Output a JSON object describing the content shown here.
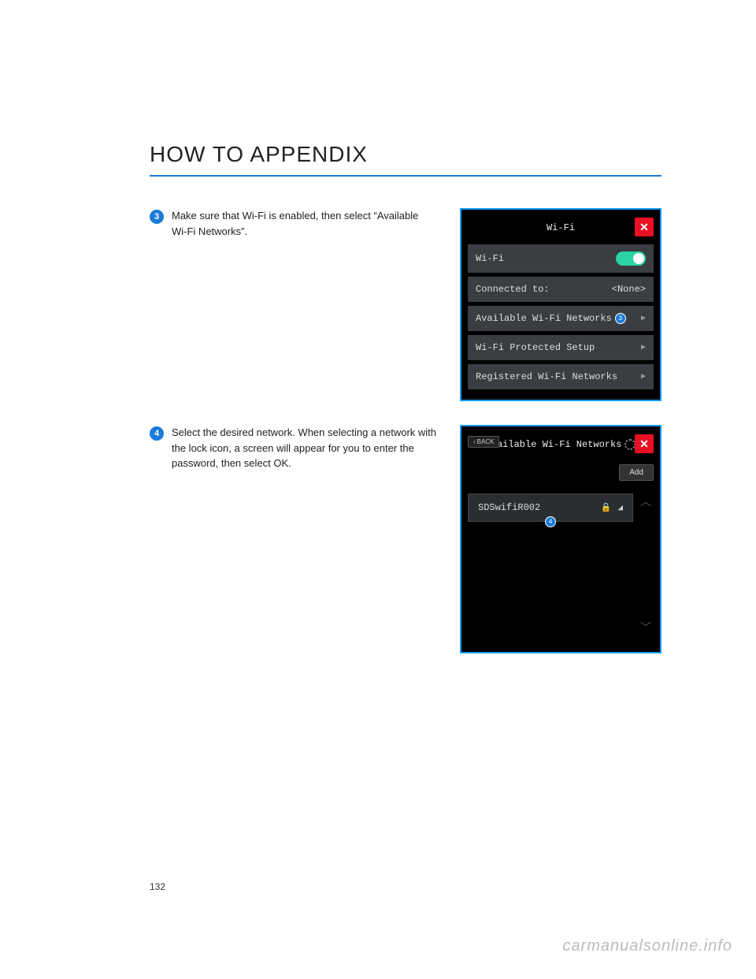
{
  "heading": "HOW TO APPENDIX",
  "step3": {
    "num": "3",
    "text": "Make sure that Wi-Fi is enabled, then select “Available Wi-Fi Networks”."
  },
  "step4": {
    "num": "4",
    "text": "Select the desired network. When selecting a network with the lock icon, a screen will appear for you to enter the password, then select OK."
  },
  "screen1": {
    "title": "Wi-Fi",
    "row_wifi": "Wi-Fi",
    "row_connected": "Connected to:",
    "connected_val": "<None>",
    "row_available": "Available Wi-Fi Networks",
    "row_protected": "Wi-Fi Protected Setup",
    "row_registered": "Registered Wi-Fi Networks",
    "badge": "3"
  },
  "screen2": {
    "back": "BACK",
    "title": "Available Wi-Fi Networks",
    "add": "Add",
    "network": "SDSwifiR002",
    "badge": "4"
  },
  "page_number": "132",
  "watermark": "carmanualsonline.info"
}
